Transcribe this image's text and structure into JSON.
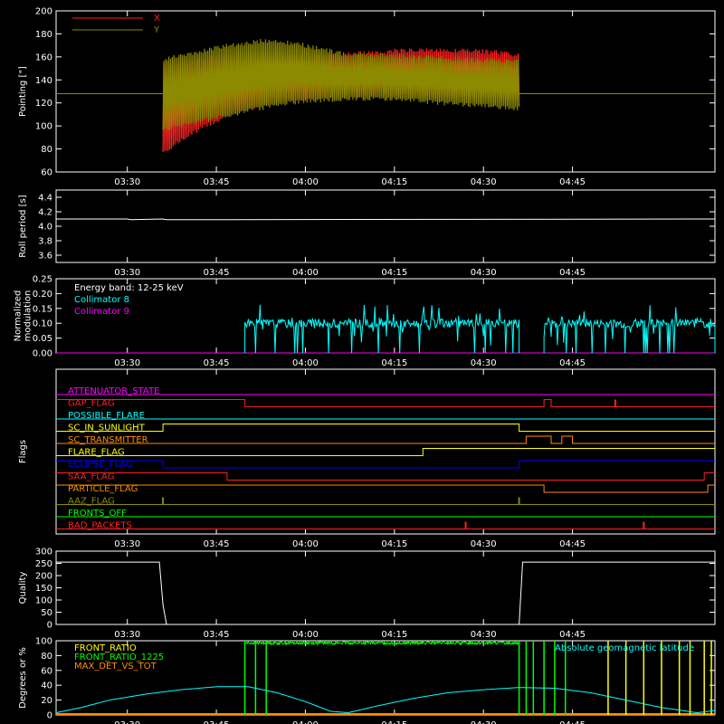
{
  "chart_data": [
    {
      "type": "line",
      "ylabel": "Pointing [\"]",
      "ylim": [
        60,
        200
      ],
      "yticks": [
        60,
        80,
        100,
        120,
        140,
        160,
        180,
        200
      ],
      "xlim": [
        3.3,
        5.15
      ],
      "xticks": [
        "03:30",
        "03:45",
        "04:00",
        "04:15",
        "04:30",
        "04:45"
      ],
      "legend": [
        {
          "name": "X",
          "color": "#ff2020"
        },
        {
          "name": "Y",
          "color": "#8c8a00"
        }
      ],
      "series": [
        {
          "name": "X",
          "color": "#ff2020",
          "start": "03:36",
          "end": "04:36",
          "upper": [
            [
              3.6,
              155
            ],
            [
              3.75,
              162
            ],
            [
              3.95,
              160
            ],
            [
              4.05,
              163
            ],
            [
              4.3,
              168
            ],
            [
              4.5,
              167
            ],
            [
              4.6,
              164
            ]
          ],
          "lower": [
            [
              3.6,
              75
            ],
            [
              3.7,
              95
            ],
            [
              3.8,
              110
            ],
            [
              3.9,
              118
            ],
            [
              4.0,
              122
            ],
            [
              4.2,
              125
            ],
            [
              4.6,
              122
            ]
          ]
        },
        {
          "name": "Y",
          "color": "#8c8a00",
          "start": "03:36",
          "end": "04:36",
          "upper": [
            [
              3.6,
              160
            ],
            [
              3.75,
              170
            ],
            [
              3.9,
              177
            ],
            [
              4.0,
              172
            ],
            [
              4.1,
              165
            ],
            [
              4.3,
              162
            ],
            [
              4.6,
              158
            ]
          ],
          "lower": [
            [
              3.6,
              95
            ],
            [
              3.75,
              105
            ],
            [
              3.9,
              115
            ],
            [
              4.0,
              120
            ],
            [
              4.2,
              122
            ],
            [
              4.6,
              113
            ]
          ],
          "baseline": 128
        }
      ]
    },
    {
      "type": "line",
      "ylabel": "Roll period [s]",
      "ylim": [
        3.5,
        4.5
      ],
      "yticks": [
        3.6,
        3.8,
        4.0,
        4.2,
        4.4
      ],
      "xticks": [
        "03:30",
        "03:45",
        "04:00",
        "04:15",
        "04:30",
        "04:45"
      ],
      "series": [
        {
          "name": "roll",
          "color": "#ffffff",
          "x": [
            3.3,
            3.5,
            3.51,
            3.6,
            3.61,
            5.15
          ],
          "y": [
            4.1,
            4.1,
            4.09,
            4.1,
            4.09,
            4.1
          ]
        }
      ]
    },
    {
      "type": "line",
      "ylabel": "Normalized\nmodulation",
      "ylim": [
        0,
        0.25
      ],
      "yticks": [
        0.0,
        0.05,
        0.1,
        0.15,
        0.2,
        0.25
      ],
      "xticks": [
        "03:30",
        "03:45",
        "04:00",
        "04:15",
        "04:30",
        "04:45"
      ],
      "annotations": [
        "Energy band: 12-25 keV"
      ],
      "legend": [
        {
          "name": "Collimator 8",
          "color": "#00ffff"
        },
        {
          "name": "Collimator 9",
          "color": "#ff00ff"
        }
      ],
      "series": [
        {
          "name": "Collimator 8",
          "color": "#00ffff",
          "segments": [
            [
              3.83,
              4.6
            ],
            [
              4.67,
              5.15
            ]
          ],
          "level": 0.1,
          "spread": [
            0.02,
            0.2
          ]
        },
        {
          "name": "Collimator 9",
          "color": "#ff00ff",
          "level": 0.0
        }
      ]
    },
    {
      "type": "line",
      "ylabel": "Flags",
      "xticks": [
        "03:30",
        "03:45",
        "04:00",
        "04:15",
        "04:30",
        "04:45"
      ],
      "flags": [
        {
          "name": "ATTENUATOR_STATE",
          "color": "#ff00ff",
          "steps": [
            [
              3.3,
              0
            ]
          ]
        },
        {
          "name": "GAP_FLAG",
          "color": "#ff2020",
          "steps": [
            [
              3.3,
              1
            ],
            [
              3.83,
              0
            ],
            [
              4.67,
              1
            ],
            [
              4.69,
              0
            ]
          ],
          "spikes": [
            4.87
          ]
        },
        {
          "name": "POSSIBLE_FLARE",
          "color": "#00ffff",
          "steps": [
            [
              3.3,
              0
            ]
          ]
        },
        {
          "name": "SC_IN_SUNLIGHT",
          "color": "#ffff00",
          "steps": [
            [
              3.3,
              0
            ],
            [
              3.6,
              1
            ],
            [
              4.6,
              0
            ]
          ]
        },
        {
          "name": "SC_TRANSMITTER",
          "color": "#ff8c00",
          "steps": [
            [
              3.3,
              0
            ],
            [
              4.62,
              1
            ],
            [
              4.69,
              0
            ],
            [
              4.72,
              1
            ],
            [
              4.75,
              0
            ]
          ]
        },
        {
          "name": "FLARE_FLAG",
          "color": "#ffff00",
          "steps": [
            [
              3.3,
              0
            ],
            [
              4.33,
              1
            ],
            [
              5.15,
              1
            ]
          ]
        },
        {
          "name": "ECLIPSE_FLAG",
          "color": "#0000ff",
          "steps": [
            [
              3.3,
              1
            ],
            [
              3.6,
              0
            ],
            [
              4.6,
              1
            ]
          ]
        },
        {
          "name": "SAA_FLAG",
          "color": "#ff2020",
          "steps": [
            [
              3.3,
              1
            ],
            [
              3.78,
              0
            ],
            [
              5.12,
              1
            ]
          ]
        },
        {
          "name": "PARTICLE_FLAG",
          "color": "#ff8c00",
          "steps": [
            [
              3.3,
              1
            ],
            [
              4.67,
              0
            ],
            [
              5.13,
              1
            ]
          ]
        },
        {
          "name": "AAZ_FLAG",
          "color": "#8c8a00",
          "steps": [
            [
              3.3,
              0
            ]
          ],
          "spikes": [
            3.6,
            4.6
          ]
        },
        {
          "name": "FRONTS_OFF",
          "color": "#00ff00",
          "steps": [
            [
              3.3,
              0
            ]
          ]
        },
        {
          "name": "BAD_PACKETS",
          "color": "#ff2020",
          "steps": [
            [
              3.3,
              0
            ]
          ],
          "spikes": [
            4.45,
            4.95
          ]
        }
      ]
    },
    {
      "type": "line",
      "ylabel": "Quality",
      "ylim": [
        0,
        300
      ],
      "yticks": [
        0,
        50,
        100,
        150,
        200,
        250,
        300
      ],
      "xticks": [
        "03:30",
        "03:45",
        "04:00",
        "04:15",
        "04:30",
        "04:45"
      ],
      "series": [
        {
          "name": "quality",
          "color": "#ffffff",
          "x": [
            3.3,
            3.59,
            3.6,
            3.61,
            4.6,
            4.61,
            5.15
          ],
          "y": [
            255,
            255,
            80,
            0,
            0,
            255,
            255
          ]
        }
      ]
    },
    {
      "type": "line",
      "ylabel": "Degrees or %",
      "ylim": [
        0,
        100
      ],
      "yticks": [
        0,
        20,
        40,
        60,
        80,
        100
      ],
      "xticks": [
        "03:30",
        "03:45",
        "04:00",
        "04:15",
        "04:30",
        "04:45"
      ],
      "legend": [
        {
          "name": "FRONT_RATIO",
          "color": "#ffff00"
        },
        {
          "name": "FRONT_RATIO_1225",
          "color": "#00ff00"
        },
        {
          "name": "MAX_DET_VS_TOT",
          "color": "#ff8c00"
        }
      ],
      "annotations": [
        "Absolute geomagnetic latitude"
      ],
      "series": [
        {
          "name": "Absolute geomagnetic latitude",
          "color": "#00ffff",
          "x": [
            3.3,
            3.37,
            3.45,
            3.55,
            3.65,
            3.75,
            3.84,
            3.92,
            4.0,
            4.07,
            4.12,
            4.2,
            4.3,
            4.4,
            4.5,
            4.6,
            4.7,
            4.8,
            4.9,
            5.0,
            5.1,
            5.15
          ],
          "y": [
            3,
            10,
            20,
            28,
            34,
            38,
            38,
            30,
            18,
            5,
            3,
            12,
            22,
            30,
            34,
            37,
            36,
            30,
            20,
            10,
            3,
            6
          ]
        },
        {
          "name": "FRONT_RATIO_1225",
          "color": "#00ff00",
          "start": "03:50",
          "end": "04:36",
          "level": 97
        },
        {
          "name": "FRONT_RATIO",
          "color": "#ffff00",
          "bars": [
            4.85,
            4.9,
            4.95,
            5.0,
            5.05,
            5.08,
            5.12,
            5.14
          ]
        },
        {
          "name": "MAX_DET_VS_TOT",
          "color": "#ff8c00",
          "level": 0
        }
      ]
    }
  ]
}
